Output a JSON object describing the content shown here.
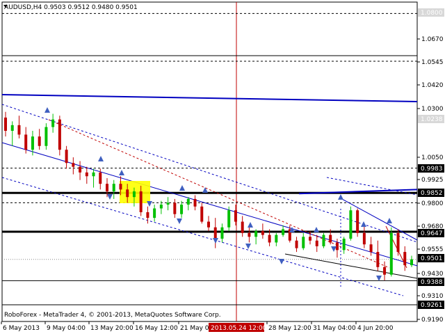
{
  "header": {
    "symbol_line": "AUDUSD,H4  0.9503 0.9512 0.9480 0.9501"
  },
  "footer": {
    "copyright": "RoboForex - MetaTrader 4, © 2001-2013, MetaQuotes Software Corp."
  },
  "price_axis": {
    "ticks": [
      "1.0670",
      "1.0545",
      "1.0420",
      "1.0300",
      "1.0050",
      "0.9925",
      "0.9800",
      "0.9680",
      "0.9555",
      "0.9430",
      "0.9310",
      "0.9190"
    ]
  },
  "price_tags": [
    {
      "text": "1.0800",
      "style": "faded"
    },
    {
      "text": "1.0238",
      "style": "faded"
    },
    {
      "text": "0.9983",
      "style": "dark"
    },
    {
      "text": "0.9852",
      "style": "dark"
    },
    {
      "text": "0.9647",
      "style": "dark"
    },
    {
      "text": "0.9501",
      "style": "dark"
    },
    {
      "text": "0.9388",
      "style": "dark"
    },
    {
      "text": "0.9261",
      "style": "dark"
    }
  ],
  "time_axis": {
    "labels": [
      "6 May 2013",
      "9 May 04:00",
      "13 May 20:00",
      "16 May 12:00",
      "21 May 0",
      "28 May 12:00",
      "31 May 04:00",
      "4 Jun 20:00"
    ],
    "highlighted_label": "2013.05.24 12:00"
  },
  "colors": {
    "background": "#ffffff",
    "axis": "#000000",
    "bull_candle": "#00c000",
    "bear_candle": "#c00000",
    "trend_blue": "#0000c0",
    "cursor_line": "#c00000",
    "marker": "#4060c0",
    "highlight_box": "#ffff00",
    "tag_dark": "#000000",
    "tag_faded": "#d8d8d8"
  },
  "chart_data": {
    "type": "candlestick",
    "y_range": [
      0.918,
      1.0805
    ],
    "price_levels": {
      "resistance_1": 1.0238,
      "level_1": 0.9983,
      "level_2": 0.9852,
      "level_3": 0.9647,
      "current": 0.9501,
      "support_1": 0.9388,
      "support_2": 0.9261,
      "top": 1.08
    },
    "ohlc": [
      [
        1.025,
        1.028,
        1.015,
        1.018
      ],
      [
        1.018,
        1.023,
        1.01,
        1.021
      ],
      [
        1.021,
        1.026,
        1.014,
        1.016
      ],
      [
        1.016,
        1.02,
        1.006,
        1.008
      ],
      [
        1.008,
        1.018,
        1.005,
        1.015
      ],
      [
        1.015,
        1.019,
        1.008,
        1.01
      ],
      [
        1.01,
        1.022,
        1.008,
        1.02
      ],
      [
        1.02,
        1.027,
        1.017,
        1.024
      ],
      [
        1.024,
        1.026,
        1.005,
        1.008
      ],
      [
        1.008,
        1.01,
        0.998,
        1.001
      ],
      [
        1.001,
        1.004,
        0.995,
        0.999
      ],
      [
        0.999,
        1.002,
        0.992,
        0.996
      ],
      [
        0.996,
        0.999,
        0.99,
        0.994
      ],
      [
        0.994,
        0.998,
        0.988,
        0.996
      ],
      [
        0.996,
        0.998,
        0.987,
        0.99
      ],
      [
        0.99,
        0.993,
        0.983,
        0.986
      ],
      [
        0.986,
        0.992,
        0.982,
        0.99
      ],
      [
        0.99,
        0.994,
        0.984,
        0.987
      ],
      [
        0.987,
        0.99,
        0.98,
        0.983
      ],
      [
        0.983,
        0.988,
        0.978,
        0.986
      ],
      [
        0.986,
        0.989,
        0.973,
        0.975
      ],
      [
        0.975,
        0.978,
        0.969,
        0.972
      ],
      [
        0.972,
        0.979,
        0.97,
        0.977
      ],
      [
        0.977,
        0.981,
        0.974,
        0.979
      ],
      [
        0.979,
        0.983,
        0.976,
        0.98
      ],
      [
        0.98,
        0.982,
        0.972,
        0.974
      ],
      [
        0.974,
        0.981,
        0.972,
        0.979
      ],
      [
        0.979,
        0.983,
        0.976,
        0.982
      ],
      [
        0.982,
        0.984,
        0.976,
        0.978
      ],
      [
        0.978,
        0.98,
        0.969,
        0.97
      ],
      [
        0.97,
        0.973,
        0.965,
        0.967
      ],
      [
        0.967,
        0.972,
        0.956,
        0.961
      ],
      [
        0.961,
        0.969,
        0.959,
        0.967
      ],
      [
        0.967,
        0.978,
        0.965,
        0.976
      ],
      [
        0.976,
        0.979,
        0.968,
        0.97
      ],
      [
        0.97,
        0.973,
        0.962,
        0.964
      ],
      [
        0.964,
        0.967,
        0.959,
        0.962
      ],
      [
        0.962,
        0.966,
        0.958,
        0.965
      ],
      [
        0.965,
        0.969,
        0.961,
        0.963
      ],
      [
        0.963,
        0.966,
        0.957,
        0.959
      ],
      [
        0.959,
        0.964,
        0.957,
        0.963
      ],
      [
        0.963,
        0.968,
        0.962,
        0.966
      ],
      [
        0.966,
        0.968,
        0.959,
        0.96
      ],
      [
        0.96,
        0.962,
        0.954,
        0.956
      ],
      [
        0.956,
        0.964,
        0.955,
        0.962
      ],
      [
        0.962,
        0.965,
        0.958,
        0.96
      ],
      [
        0.96,
        0.963,
        0.954,
        0.957
      ],
      [
        0.957,
        0.964,
        0.956,
        0.963
      ],
      [
        0.963,
        0.966,
        0.958,
        0.959
      ],
      [
        0.959,
        0.961,
        0.951,
        0.955
      ],
      [
        0.955,
        0.962,
        0.953,
        0.961
      ],
      [
        0.961,
        0.978,
        0.96,
        0.976
      ],
      [
        0.976,
        0.977,
        0.962,
        0.964
      ],
      [
        0.964,
        0.968,
        0.956,
        0.958
      ],
      [
        0.958,
        0.962,
        0.952,
        0.954
      ],
      [
        0.954,
        0.96,
        0.944,
        0.946
      ],
      [
        0.946,
        0.949,
        0.939,
        0.942
      ],
      [
        0.942,
        0.967,
        0.941,
        0.964
      ],
      [
        0.964,
        0.966,
        0.952,
        0.954
      ],
      [
        0.954,
        0.957,
        0.944,
        0.947
      ],
      [
        0.947,
        0.952,
        0.946,
        0.9501
      ]
    ],
    "ylim": [
      0.918,
      1.0805
    ]
  }
}
